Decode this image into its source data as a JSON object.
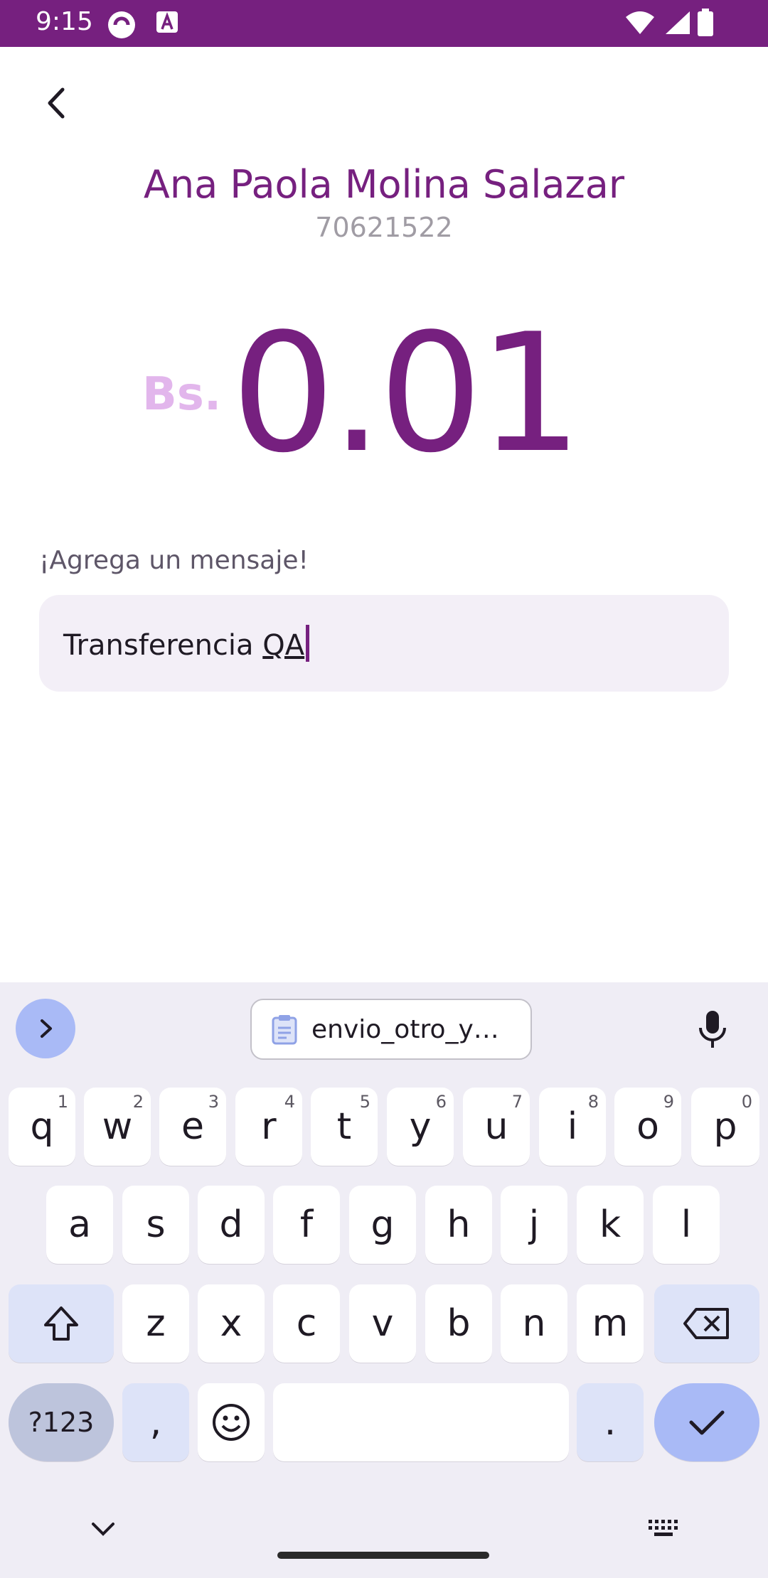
{
  "status_bar": {
    "time": "9:15"
  },
  "header": {
    "back_icon": "chevron-left-icon"
  },
  "contact": {
    "name": "Ana Paola Molina Salazar",
    "phone": "70621522"
  },
  "amount": {
    "currency": "Bs.",
    "value": "0.01"
  },
  "message": {
    "label": "¡Agrega un mensaje!",
    "text_plain": "Transferencia ",
    "text_underlined": "QA"
  },
  "keyboard": {
    "clipboard_suggestion": "envio_otro_y…",
    "row1": [
      {
        "key": "q",
        "hint": "1"
      },
      {
        "key": "w",
        "hint": "2"
      },
      {
        "key": "e",
        "hint": "3"
      },
      {
        "key": "r",
        "hint": "4"
      },
      {
        "key": "t",
        "hint": "5"
      },
      {
        "key": "y",
        "hint": "6"
      },
      {
        "key": "u",
        "hint": "7"
      },
      {
        "key": "i",
        "hint": "8"
      },
      {
        "key": "o",
        "hint": "9"
      },
      {
        "key": "p",
        "hint": "0"
      }
    ],
    "row2": [
      "a",
      "s",
      "d",
      "f",
      "g",
      "h",
      "j",
      "k",
      "l"
    ],
    "row3": [
      "z",
      "x",
      "c",
      "v",
      "b",
      "n",
      "m"
    ],
    "symbols_label": "?123",
    "comma": ",",
    "period": "."
  },
  "colors": {
    "brand": "#76207f",
    "currency_light": "#e2b6ec",
    "accent_blue": "#a9baf6"
  }
}
